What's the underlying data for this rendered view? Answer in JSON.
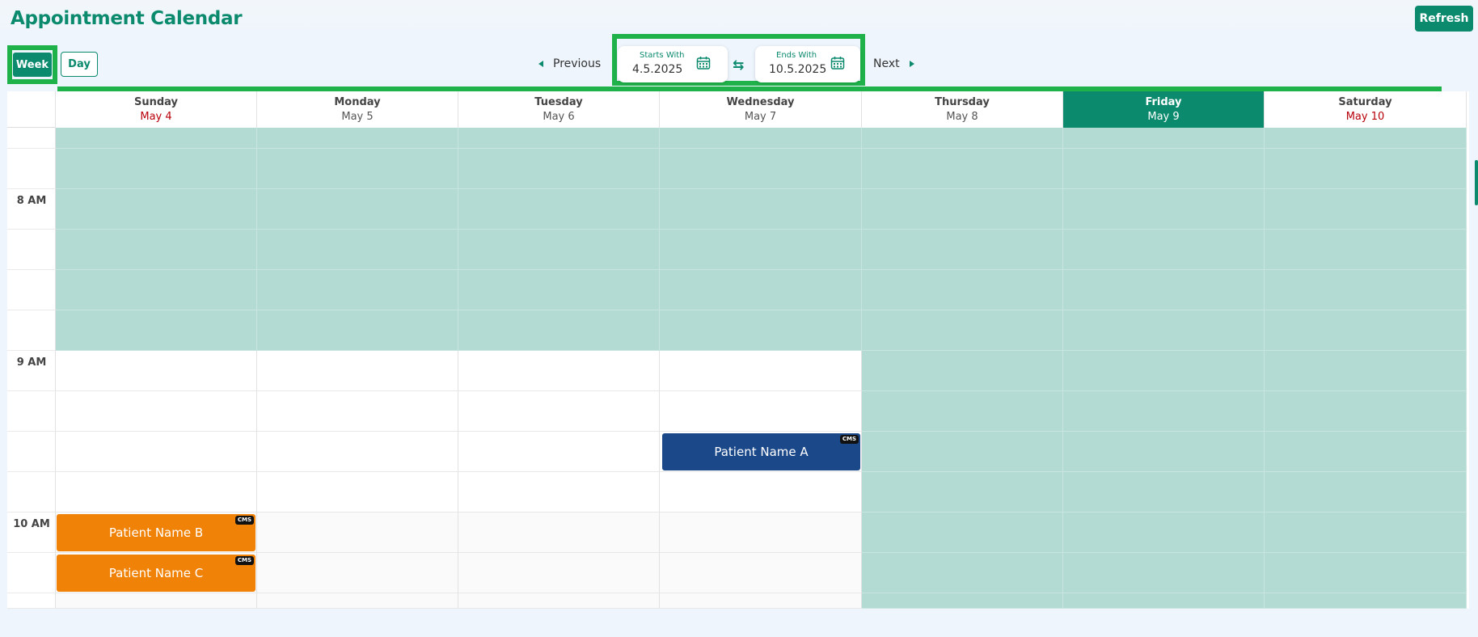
{
  "app": {
    "title": "Appointment Calendar",
    "refresh_label": "Refresh"
  },
  "toolbar": {
    "view_modes": [
      {
        "label": "Week",
        "active": true
      },
      {
        "label": "Day",
        "active": false
      }
    ],
    "previous_label": "Previous",
    "next_label": "Next",
    "start": {
      "label": "Starts With",
      "value": "4.5.2025"
    },
    "end": {
      "label": "Ends With",
      "value": "10.5.2025"
    },
    "swap_icon": "swap-arrows-icon"
  },
  "days": [
    {
      "name": "Sunday",
      "date": "May 4",
      "weekend": true,
      "today": false
    },
    {
      "name": "Monday",
      "date": "May 5",
      "weekend": false,
      "today": false
    },
    {
      "name": "Tuesday",
      "date": "May 6",
      "weekend": false,
      "today": false
    },
    {
      "name": "Wednesday",
      "date": "May 7",
      "weekend": false,
      "today": false
    },
    {
      "name": "Thursday",
      "date": "May 8",
      "weekend": false,
      "today": false
    },
    {
      "name": "Friday",
      "date": "May 9",
      "weekend": false,
      "today": true
    },
    {
      "name": "Saturday",
      "date": "May 10",
      "weekend": true,
      "today": false
    }
  ],
  "time_labels": [
    "8 AM",
    "9 AM",
    "10 AM"
  ],
  "appointments": [
    {
      "patient": "Patient Name A",
      "badge": "CMS",
      "day": "Wednesday",
      "start": "9:30 AM",
      "color": "#1b4889"
    },
    {
      "patient": "Patient Name B",
      "badge": "CMS",
      "day": "Sunday",
      "start": "10:00 AM",
      "color": "#ef8207"
    },
    {
      "patient": "Patient Name C",
      "badge": "CMS",
      "day": "Sunday",
      "start": "10:15 AM",
      "color": "#ef8207"
    }
  ],
  "colors": {
    "accent": "#0b8a6e",
    "blocked_slot": "#b4dbd3",
    "weekend_date": "#b8000a",
    "highlight": "#1fb24a"
  }
}
